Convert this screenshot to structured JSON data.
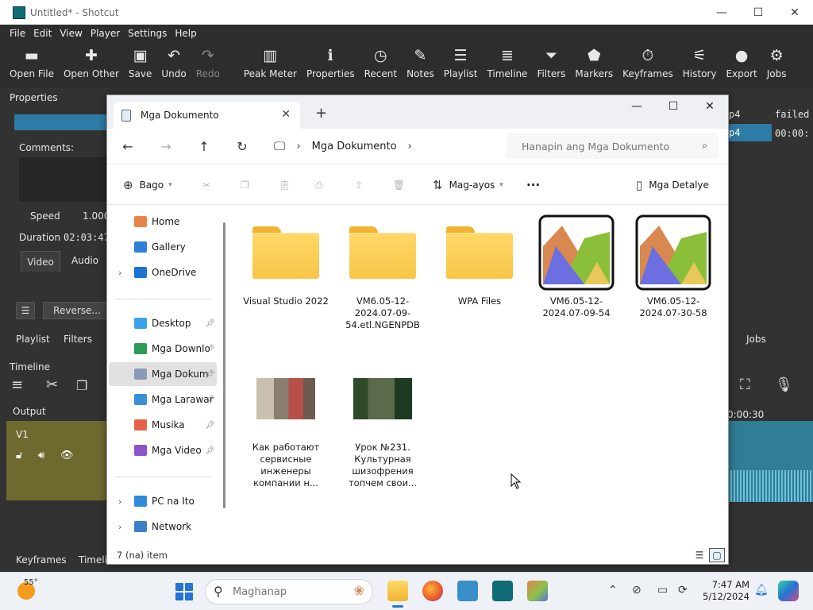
{
  "shotcut": {
    "title": "Untitled* - Shotcut",
    "window_controls": [
      "—",
      "☐",
      "✕"
    ],
    "menu": [
      "File",
      "Edit",
      "View",
      "Player",
      "Settings",
      "Help"
    ],
    "toolbar": [
      {
        "label": "Open File",
        "icon": "▬",
        "disabled": false
      },
      {
        "label": "Open Other",
        "icon": "✚",
        "disabled": false
      },
      {
        "label": "Save",
        "icon": "▣",
        "disabled": false
      },
      {
        "label": "Undo",
        "icon": "↶",
        "disabled": false
      },
      {
        "label": "Redo",
        "icon": "↷",
        "disabled": true
      },
      {
        "label": "Peak Meter",
        "icon": "▥",
        "disabled": false
      },
      {
        "label": "Properties",
        "icon": "ℹ",
        "disabled": false
      },
      {
        "label": "Recent",
        "icon": "◷",
        "disabled": false
      },
      {
        "label": "Notes",
        "icon": "✎",
        "disabled": false
      },
      {
        "label": "Playlist",
        "icon": "☰",
        "disabled": false
      },
      {
        "label": "Timeline",
        "icon": "≣",
        "disabled": false
      },
      {
        "label": "Filters",
        "icon": "⏷",
        "disabled": false
      },
      {
        "label": "Markers",
        "icon": "⬟",
        "disabled": false
      },
      {
        "label": "Keyframes",
        "icon": "⏱",
        "disabled": false
      },
      {
        "label": "History",
        "icon": "⚟",
        "disabled": false
      },
      {
        "label": "Export",
        "icon": "●",
        "disabled": false
      },
      {
        "label": "Jobs",
        "icon": "⚙",
        "disabled": false
      }
    ],
    "left_panel": {
      "properties_title": "Properties",
      "comments_label": "Comments:",
      "speed_label": "Speed",
      "speed_value": "1.0000",
      "duration_label": "Duration",
      "duration_value": "02:03:47",
      "tab_video": "Video",
      "tab_audio": "Audio",
      "reverse_button": "Reverse...",
      "playlist_tab": "Playlist",
      "filters_tab": "Filters",
      "timeline_title": "Timeline",
      "output_label": "Output",
      "track_v1": "V1",
      "keyframes_tab": "Keyframes",
      "timeline_tab": "Timeli"
    },
    "right_panel": {
      "job_name": "p4",
      "job_status": "failed",
      "job_name2": "p4",
      "job_time": "00:00:",
      "jobs_tab": "Jobs",
      "ruler_time": "0:00:30"
    }
  },
  "explorer": {
    "tab_title": "Mga Dokumento",
    "tab_close": "✕",
    "new_tab": "+",
    "window_controls": [
      "—",
      "☐",
      "✕"
    ],
    "breadcrumb": "Mga Dokumento",
    "search_placeholder": "Hanapin ang Mga Dokumento",
    "commands": {
      "new_label": "Bago",
      "sort_label": "Mag-ayos",
      "more_label": "···",
      "details_label": "Mga Detalye"
    },
    "nav_items": [
      {
        "label": "Home",
        "color": "#e8834a",
        "pinned": false,
        "chevron": false
      },
      {
        "label": "Gallery",
        "color": "#2f7fd6",
        "pinned": false,
        "chevron": false
      },
      {
        "label": "OneDrive",
        "color": "#1b73d3",
        "pinned": false,
        "chevron": true
      },
      {
        "label": "Desktop",
        "color": "#3aa2e8",
        "pinned": true,
        "chevron": false
      },
      {
        "label": "Mga Downlo",
        "color": "#2d9a55",
        "pinned": true,
        "chevron": false
      },
      {
        "label": "Mga Dokum",
        "color": "#8a9bb8",
        "pinned": true,
        "chevron": false
      },
      {
        "label": "Mga Larawar",
        "color": "#3a8fd9",
        "pinned": true,
        "chevron": false
      },
      {
        "label": "Musika",
        "color": "#e8604a",
        "pinned": true,
        "chevron": false
      },
      {
        "label": "Mga Video",
        "color": "#8b55c8",
        "pinned": true,
        "chevron": false
      },
      {
        "label": "PC na Ito",
        "color": "#2f8ad9",
        "pinned": false,
        "chevron": true
      },
      {
        "label": "Network",
        "color": "#3a7fc9",
        "pinned": false,
        "chevron": true
      }
    ],
    "files": [
      {
        "name": "Visual Studio 2022",
        "type": "folder"
      },
      {
        "name": "VM6.05-12-2024.07-09-54.etl.NGENPDB",
        "type": "folder"
      },
      {
        "name": "WPA Files",
        "type": "folder"
      },
      {
        "name": "VM6.05-12-2024.07-09-54",
        "type": "wpa"
      },
      {
        "name": "VM6.05-12-2024.07-30-58",
        "type": "wpa"
      },
      {
        "name": "Как работают сервисные инженеры компании н...",
        "type": "video1"
      },
      {
        "name": "Урок №231. Культурная шизофрения топчем свои...",
        "type": "video2"
      }
    ],
    "status_text": "7 (na) item"
  },
  "taskbar": {
    "temperature": "55°",
    "search_placeholder": "Maghanap",
    "time": "7:47 AM",
    "date": "5/12/2024"
  }
}
